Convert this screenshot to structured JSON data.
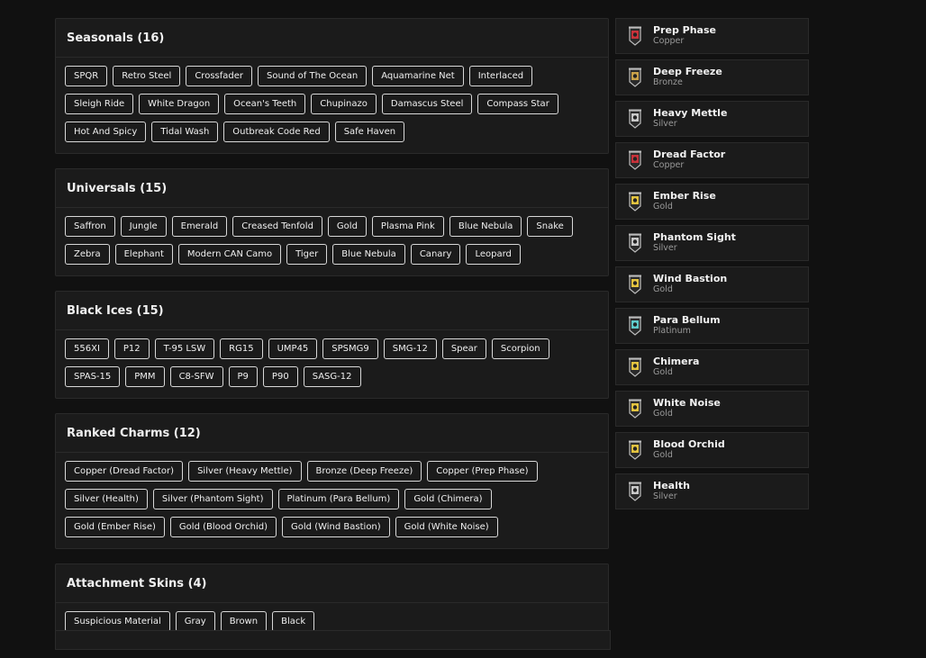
{
  "sections": [
    {
      "title": "Seasonals (16)",
      "items": [
        "SPQR",
        "Retro Steel",
        "Crossfader",
        "Sound of The Ocean",
        "Aquamarine Net",
        "Interlaced",
        "Sleigh Ride",
        "White Dragon",
        "Ocean's Teeth",
        "Chupinazo",
        "Damascus Steel",
        "Compass Star",
        "Hot And Spicy",
        "Tidal Wash",
        "Outbreak Code Red",
        "Safe Haven"
      ]
    },
    {
      "title": "Universals (15)",
      "items": [
        "Saffron",
        "Jungle",
        "Emerald",
        "Creased Tenfold",
        "Gold",
        "Plasma Pink",
        "Blue Nebula",
        "Snake",
        "Zebra",
        "Elephant",
        "Modern CAN Camo",
        "Tiger",
        "Blue Nebula",
        "Canary",
        "Leopard"
      ]
    },
    {
      "title": "Black Ices (15)",
      "items": [
        "556XI",
        "P12",
        "T-95 LSW",
        "RG15",
        "UMP45",
        "SPSMG9",
        "SMG-12",
        "Spear",
        "Scorpion",
        "SPAS-15",
        "PMM",
        "C8-SFW",
        "P9",
        "P90",
        "SASG-12"
      ]
    },
    {
      "title": "Ranked Charms (12)",
      "items": [
        "Copper (Dread Factor)",
        "Silver (Heavy Mettle)",
        "Bronze (Deep Freeze)",
        "Copper (Prep Phase)",
        "Silver (Health)",
        "Silver (Phantom Sight)",
        "Platinum (Para Bellum)",
        "Gold (Chimera)",
        "Gold (Ember Rise)",
        "Gold (Blood Orchid)",
        "Gold (Wind Bastion)",
        "Gold (White Noise)"
      ]
    },
    {
      "title": "Attachment Skins (4)",
      "items": [
        "Suspicious Material",
        "Gray",
        "Brown",
        "Black"
      ]
    }
  ],
  "tier_colors": {
    "Copper": "#c8323a",
    "Bronze": "#c9a24a",
    "Silver": "#c8c8c8",
    "Gold": "#e3c340",
    "Platinum": "#5ec9c9"
  },
  "charms": [
    {
      "name": "Prep Phase",
      "tier": "Copper"
    },
    {
      "name": "Deep Freeze",
      "tier": "Bronze"
    },
    {
      "name": "Heavy Mettle",
      "tier": "Silver"
    },
    {
      "name": "Dread Factor",
      "tier": "Copper"
    },
    {
      "name": "Ember Rise",
      "tier": "Gold"
    },
    {
      "name": "Phantom Sight",
      "tier": "Silver"
    },
    {
      "name": "Wind Bastion",
      "tier": "Gold"
    },
    {
      "name": "Para Bellum",
      "tier": "Platinum"
    },
    {
      "name": "Chimera",
      "tier": "Gold"
    },
    {
      "name": "White Noise",
      "tier": "Gold"
    },
    {
      "name": "Blood Orchid",
      "tier": "Gold"
    },
    {
      "name": "Health",
      "tier": "Silver"
    }
  ]
}
